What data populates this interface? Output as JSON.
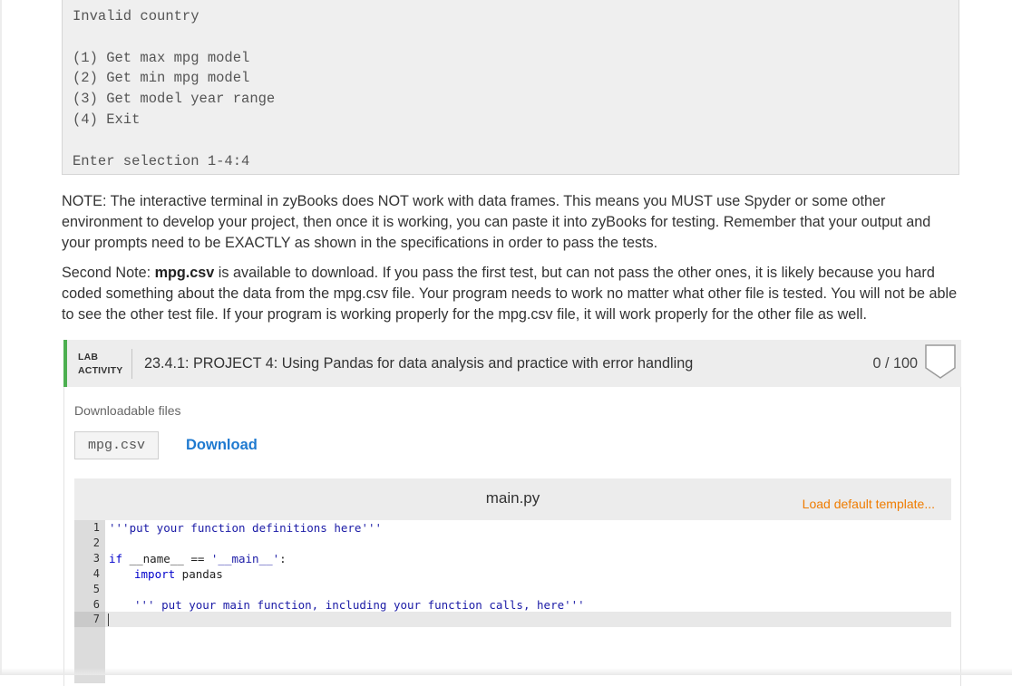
{
  "terminal": {
    "lines": [
      "Invalid country",
      "",
      "(1) Get max mpg model",
      "(2) Get min mpg model",
      "(3) Get model year range",
      "(4) Exit",
      "",
      "Enter selection 1-4:4"
    ]
  },
  "notes": {
    "note1": "NOTE: The interactive terminal in zyBooks does NOT work with data frames. This means you MUST use Spyder or some other environment to develop your project, then once it is working, you can paste it into zyBooks for testing. Remember that your output and your prompts need to be EXACTLY as shown in the specifications in order to pass the tests.",
    "note2_prefix": "Second Note: ",
    "note2_file": "mpg.csv",
    "note2_rest": " is available to download. If you pass the first test, but can not pass the other ones, it is likely because you hard coded something about the data from the mpg.csv file. Your program needs to work no matter what other file is tested. You will not be able to see the other test file. If your program is working properly for the mpg.csv file, it will work properly for the other file as well."
  },
  "lab": {
    "tag_line1": "LAB",
    "tag_line2": "ACTIVITY",
    "title": "23.4.1: PROJECT 4: Using Pandas for data analysis and practice with error handling",
    "score": "0 / 100",
    "accent_color": "#4caf50",
    "downloadable_label": "Downloadable files",
    "file_name": "mpg.csv",
    "download_label": "Download"
  },
  "editor": {
    "file_name": "main.py",
    "load_template_label": "Load default template...",
    "line_numbers": [
      "1",
      "2",
      "3",
      "4",
      "5",
      "6",
      "7"
    ],
    "code": {
      "l1": "'''put your function definitions here'''",
      "l3_kw": "if",
      "l3_mid": " __name__ == ",
      "l3_str": "'__main__'",
      "l3_end": ":",
      "l4_kw": "import",
      "l4_rest": " pandas",
      "l6": "''' put your main function, including your function calls, here'''"
    }
  }
}
